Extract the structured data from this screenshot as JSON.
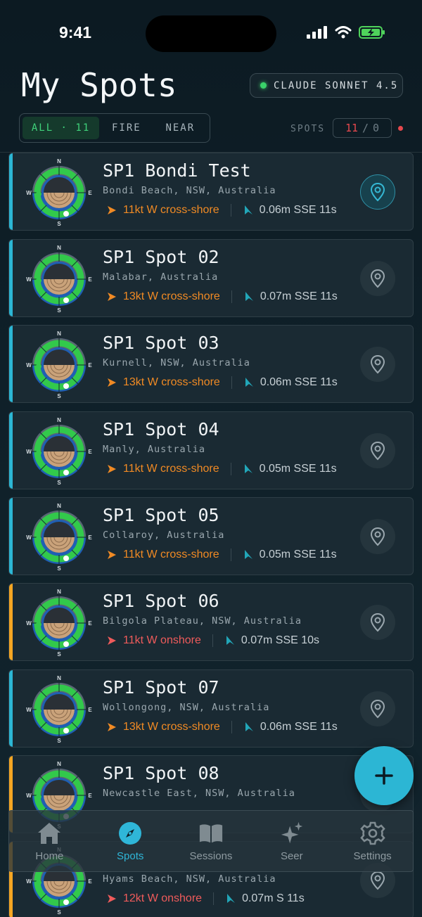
{
  "status_bar": {
    "time": "9:41"
  },
  "header": {
    "title": "My Spots",
    "model_badge": "CLAUDE SONNET 4.5",
    "filters": [
      {
        "label": "ALL · 11",
        "active": true
      },
      {
        "label": "FIRE",
        "active": false
      },
      {
        "label": "NEAR",
        "active": false
      }
    ],
    "spots_label": "SPOTS",
    "spots_total": "11",
    "spots_sep": "/",
    "spots_fire": "0"
  },
  "colors": {
    "accent_cyan": "#2cb6d4",
    "accent_orange": "#f5a623",
    "wind_cross": "#f08a24",
    "wind_onshore": "#ef5b5b",
    "swell": "#22a6b8"
  },
  "spots": [
    {
      "name": "SP1 Bondi Test",
      "location": "Bondi Beach, NSW, Australia",
      "wind": "11kt W cross-shore",
      "wind_type": "cross",
      "swell": "0.06m SSE 11s",
      "accent": "cyan",
      "pin_active": true
    },
    {
      "name": "SP1 Spot 02",
      "location": "Malabar, Australia",
      "wind": "13kt W cross-shore",
      "wind_type": "cross",
      "swell": "0.07m SSE 11s",
      "accent": "cyan",
      "pin_active": false
    },
    {
      "name": "SP1 Spot 03",
      "location": "Kurnell, NSW, Australia",
      "wind": "13kt W cross-shore",
      "wind_type": "cross",
      "swell": "0.06m SSE 11s",
      "accent": "cyan",
      "pin_active": false
    },
    {
      "name": "SP1 Spot 04",
      "location": "Manly, Australia",
      "wind": "11kt W cross-shore",
      "wind_type": "cross",
      "swell": "0.05m SSE 11s",
      "accent": "cyan",
      "pin_active": false
    },
    {
      "name": "SP1 Spot 05",
      "location": "Collaroy, Australia",
      "wind": "11kt W cross-shore",
      "wind_type": "cross",
      "swell": "0.05m SSE 11s",
      "accent": "cyan",
      "pin_active": false
    },
    {
      "name": "SP1 Spot 06",
      "location": "Bilgola Plateau, NSW, Australia",
      "wind": "11kt W onshore",
      "wind_type": "onshore",
      "swell": "0.07m SSE 10s",
      "accent": "orange",
      "pin_active": false
    },
    {
      "name": "SP1 Spot 07",
      "location": "Wollongong, NSW, Australia",
      "wind": "13kt W cross-shore",
      "wind_type": "cross",
      "swell": "0.06m SSE 11s",
      "accent": "cyan",
      "pin_active": false
    },
    {
      "name": "SP1 Spot 08",
      "location": "Newcastle East, NSW, Australia",
      "wind": "",
      "wind_type": "onshore",
      "swell": "",
      "accent": "orange",
      "pin_active": false
    },
    {
      "name": "",
      "location": "Hyams Beach, NSW, Australia",
      "wind": "12kt W onshore",
      "wind_type": "onshore",
      "swell": "0.07m S 11s",
      "accent": "orange",
      "pin_active": false
    }
  ],
  "compass": {
    "n": "N",
    "e": "E",
    "s": "S",
    "w": "W"
  },
  "tabs": [
    {
      "label": "Home",
      "icon": "home-icon",
      "active": false
    },
    {
      "label": "Spots",
      "icon": "compass-icon",
      "active": true
    },
    {
      "label": "Sessions",
      "icon": "book-icon",
      "active": false
    },
    {
      "label": "Seer",
      "icon": "sparkles-icon",
      "active": false
    },
    {
      "label": "Settings",
      "icon": "gear-icon",
      "active": false
    }
  ],
  "fab": {
    "icon": "plus-icon"
  }
}
